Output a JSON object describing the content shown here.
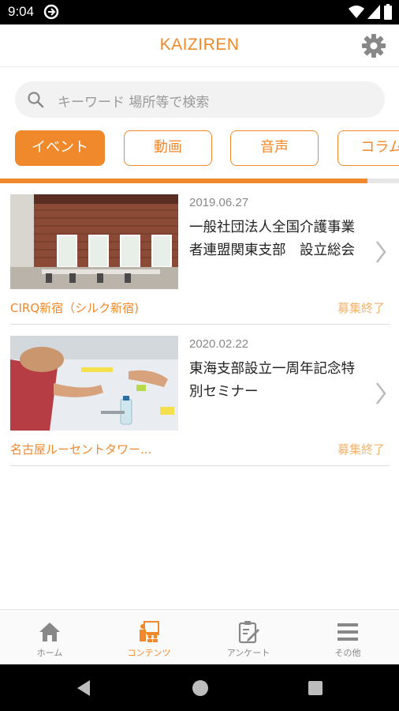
{
  "status_bar": {
    "time": "9:04"
  },
  "app_bar": {
    "title": "KAIZIREN"
  },
  "search": {
    "placeholder": "キーワード 場所等で検索"
  },
  "tabs": [
    {
      "label": "イベント",
      "active": true
    },
    {
      "label": "動画",
      "active": false
    },
    {
      "label": "音声",
      "active": false
    },
    {
      "label": "コラム",
      "active": false
    }
  ],
  "tab_scroll_progress": 0.92,
  "events": [
    {
      "date": "2019.06.27",
      "title": "一般社団法人全国介護事業者連盟関東支部　設立総会",
      "venue": "CIRQ新宿（シルク新宿)",
      "status": "募集終了"
    },
    {
      "date": "2020.02.22",
      "title": "東海支部設立一周年記念特別セミナー",
      "venue": "名古屋ルーセントタワー...",
      "status": "募集終了"
    }
  ],
  "bottom_nav": [
    {
      "label": "ホーム",
      "icon": "home-icon"
    },
    {
      "label": "コンテンツ",
      "icon": "contents-icon",
      "active": true
    },
    {
      "label": "アンケート",
      "icon": "survey-icon"
    },
    {
      "label": "その他",
      "icon": "menu-icon"
    }
  ],
  "colors": {
    "accent": "#f0892b",
    "status_text": "#f2b36c"
  }
}
